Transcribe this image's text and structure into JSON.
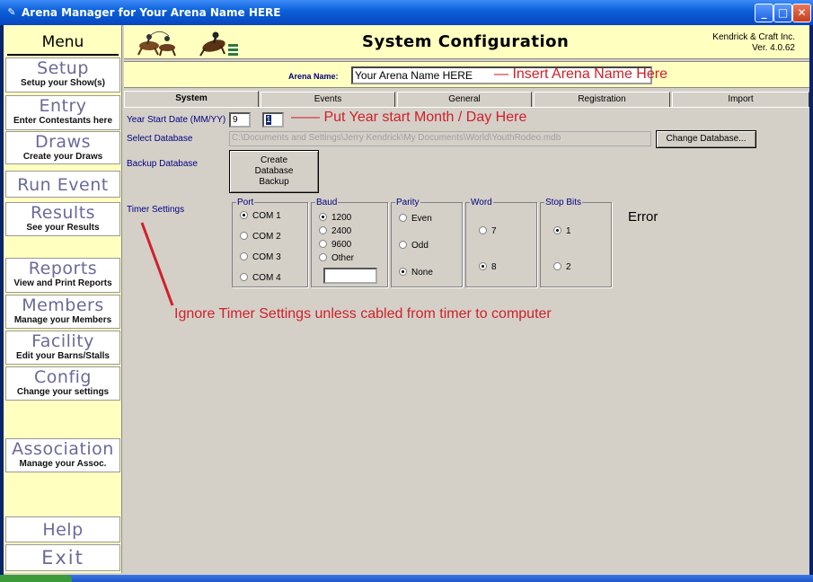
{
  "window": {
    "title": "Arena Manager for Your Arena Name HERE",
    "minimize_icon": "minimize-icon",
    "maximize_icon": "maximize-icon",
    "close_icon": "close-icon"
  },
  "sidebar": {
    "heading": "Menu",
    "items": [
      {
        "label": "Setup",
        "sub": "Setup your Show(s)"
      },
      {
        "label": "Entry",
        "sub": "Enter Contestants here"
      },
      {
        "label": "Draws",
        "sub": "Create your Draws"
      },
      {
        "label": "Run Event",
        "sub": ""
      },
      {
        "label": "Results",
        "sub": "See your Results"
      },
      {
        "label": "Reports",
        "sub": "View and Print Reports"
      },
      {
        "label": "Members",
        "sub": "Manage your Members"
      },
      {
        "label": "Facility",
        "sub": "Edit your Barns/Stalls"
      },
      {
        "label": "Config",
        "sub": "Change your settings"
      },
      {
        "label": "Association",
        "sub": "Manage your Assoc."
      },
      {
        "label": "Help",
        "sub": ""
      },
      {
        "label": "Exit",
        "sub": ""
      }
    ]
  },
  "header": {
    "title": "System Configuration",
    "company": "Kendrick & Craft Inc.",
    "version": "Ver. 4.0.62",
    "logo_left_icon": "team-roping-logo-icon",
    "logo_right_icon": "barrel-racer-logo-icon"
  },
  "arena": {
    "label": "Arena Name:",
    "value": "Your Arena Name HERE",
    "annotation": "— Insert Arena Name Here"
  },
  "tabs": [
    "System",
    "Events",
    "General",
    "Registration",
    "Import"
  ],
  "active_tab": "System",
  "system": {
    "year_start_label": "Year Start Date (MM/YY)",
    "year_start_month": "9",
    "year_start_day": "1",
    "year_start_annotation": "—— Put Year start Month / Day Here",
    "select_db_label": "Select Database",
    "db_path": "C:\\Documents and Settings\\Jerry Kendrick\\My Documents\\World\\YouthRodeo.mdb",
    "change_db_button": "Change Database...",
    "backup_label": "Backup Database",
    "backup_button": "Create Database Backup",
    "timer_label": "Timer Settings",
    "timer_annotation": "Ignore Timer Settings unless cabled from timer to computer",
    "error_text": "Error",
    "port": {
      "title": "Port",
      "options": [
        "COM 1",
        "COM 2",
        "COM 3",
        "COM 4"
      ],
      "selected": "COM 1"
    },
    "baud": {
      "title": "Baud",
      "options": [
        "1200",
        "2400",
        "9600",
        "Other"
      ],
      "selected": "1200",
      "other_value": ""
    },
    "parity": {
      "title": "Parity",
      "options": [
        "Even",
        "Odd",
        "None"
      ],
      "selected": "None"
    },
    "word": {
      "title": "Word",
      "options": [
        "7",
        "8"
      ],
      "selected": "8"
    },
    "stop_bits": {
      "title": "Stop Bits",
      "options": [
        "1",
        "2"
      ],
      "selected": "1"
    }
  },
  "colors": {
    "sidebar_bg": "#ffffc0",
    "annotation_red": "#d0202a",
    "nav_text": "#6a6a9a",
    "label_blue": "#000080"
  }
}
